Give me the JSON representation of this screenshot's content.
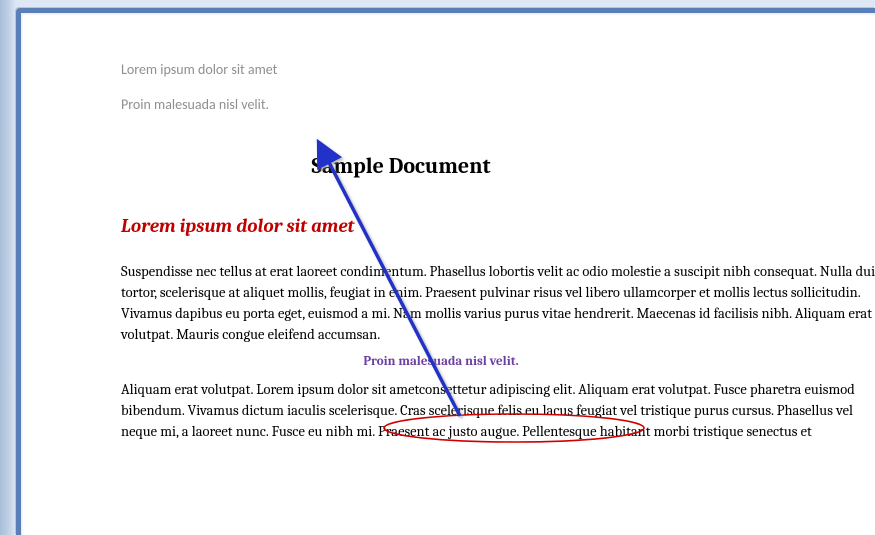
{
  "header": {
    "line1": "Lorem ipsum dolor sit amet",
    "line2": "Proin malesuada nisl velit."
  },
  "document": {
    "title": "Sample Document",
    "heading_red": "Lorem ipsum dolor sit amet",
    "paragraph1": "Suspendisse nec tellus at erat laoreet condimentum. Phasellus lobortis velit ac odio molestie a suscipit nibh consequat. Nulla dui tortor, scelerisque at aliquet mollis, feugiat in enim. Praesent  pulvinar risus vel libero ullamcorper et mollis lectus sollicitudin. Vivamus dapibus eu porta eget, euismod a mi. Nam mollis varius purus vitae hendrerit. Maecenas id facilisis  nibh. Aliquam erat volutpat. Mauris congue eleifend  accumsan.",
    "callout": "Proin malesuada nisl velit.",
    "paragraph2": "Aliquam erat volutpat. Lorem ipsum dolor sit ametconsettetur adipiscing elit.  Aliquam erat volutpat. Fusce pharetra euismod bibendum. Vivamus dictum iaculis scelerisque. Cras scelerisque felis eu lacus feugiat vel tristique purus cursus. Phasellus vel neque mi, a laoreet nunc. Fusce eu nibh mi. Praesent ac justo augue. Pellentesque habitant morbi tristique senectus et"
  },
  "annotations": {
    "arrow_color": "#2030c8",
    "ellipse_color": "#d00000"
  }
}
